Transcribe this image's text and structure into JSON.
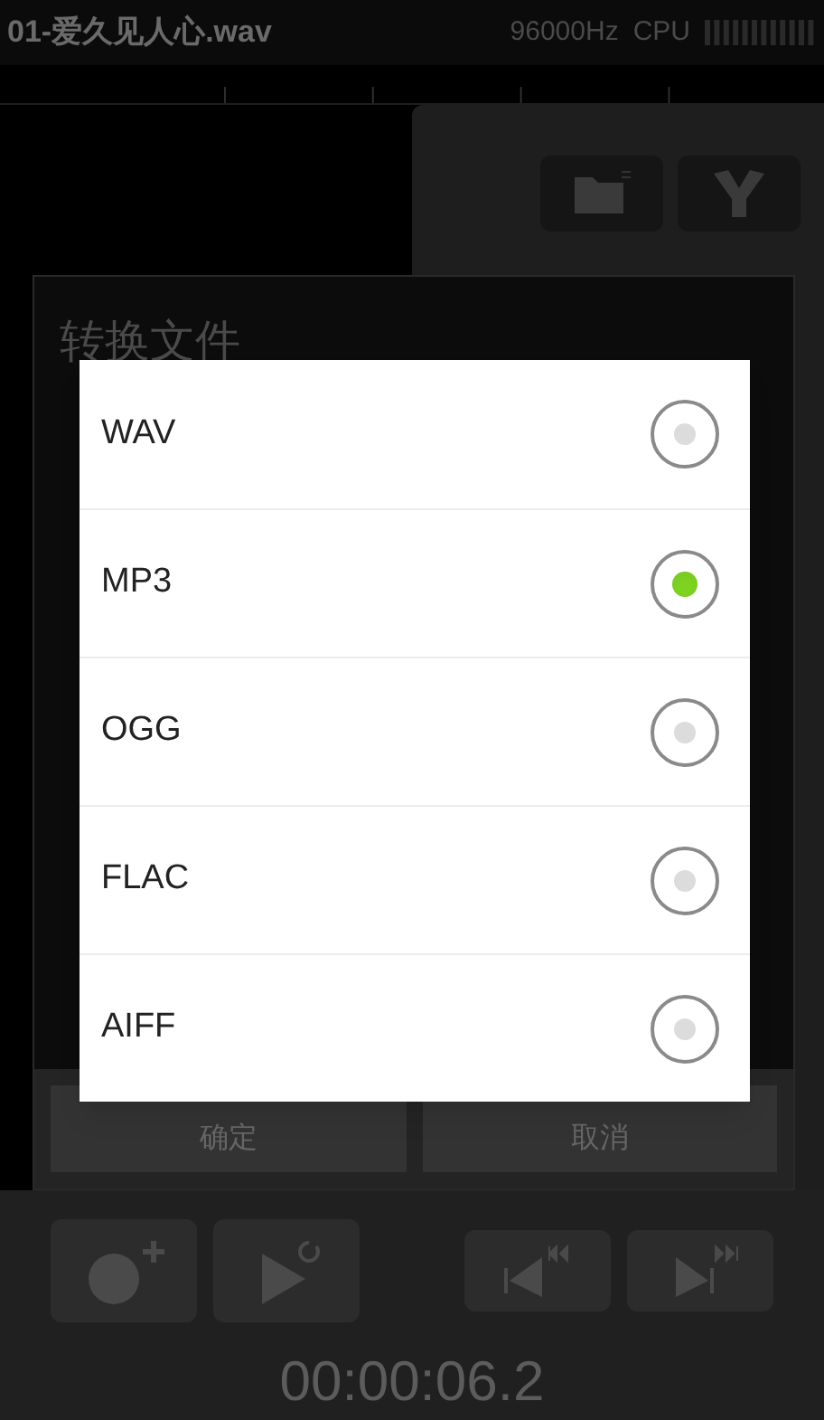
{
  "header": {
    "file_name": "01-爱久见人心.wav",
    "sample_rate": "96000Hz",
    "cpu_label": "CPU"
  },
  "dialog": {
    "title": "转换文件",
    "buttons": [
      {
        "label": "确定"
      },
      {
        "label": "取消"
      }
    ]
  },
  "format_picker": {
    "options": [
      {
        "label": "WAV",
        "selected": false
      },
      {
        "label": "MP3",
        "selected": true
      },
      {
        "label": "OGG",
        "selected": false
      },
      {
        "label": "FLAC",
        "selected": false
      },
      {
        "label": "AIFF",
        "selected": false
      }
    ]
  },
  "transport": {
    "time": "00:00:06.2"
  }
}
